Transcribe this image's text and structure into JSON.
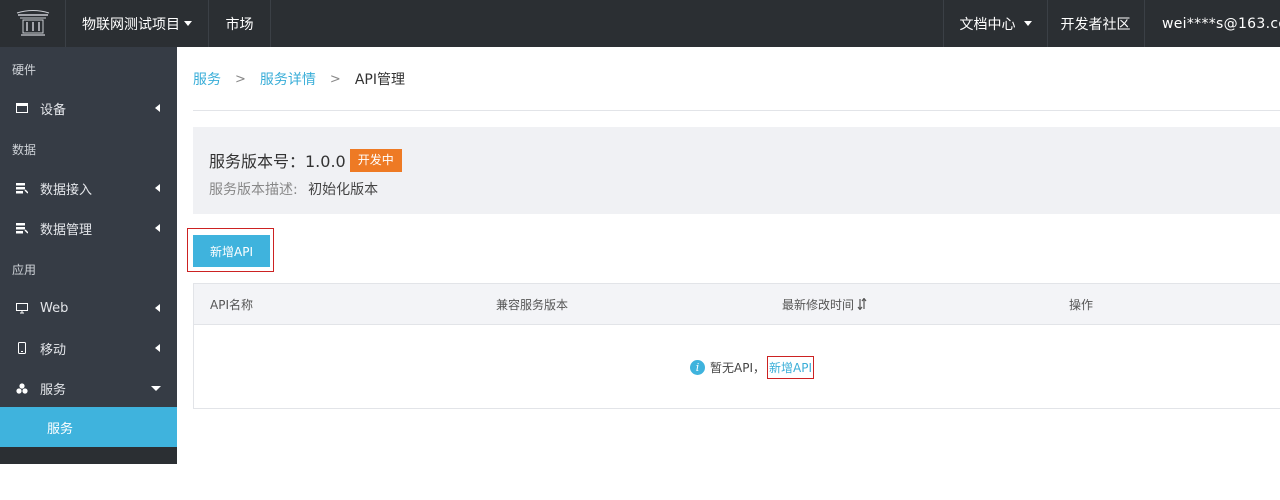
{
  "topbar": {
    "project": "物联网测试项目",
    "market": "市场",
    "docs": "文档中心",
    "community": "开发者社区",
    "user": "wei****s@163.co"
  },
  "sidebar": {
    "sections": {
      "hardware": "硬件",
      "data": "数据",
      "app": "应用"
    },
    "items": {
      "device": "设备",
      "data_ingest": "数据接入",
      "data_manage": "数据管理",
      "web": "Web",
      "mobile": "移动",
      "service": "服务"
    },
    "sub_active": "服务"
  },
  "breadcrumb": {
    "l1": "服务",
    "l2": "服务详情",
    "current": "API管理",
    "sep": ">"
  },
  "version": {
    "title": "服务版本号：1.0.0",
    "badge": "开发中",
    "desc_label": "服务版本描述:",
    "desc_value": "初始化版本"
  },
  "actions": {
    "add_api": "新增API"
  },
  "table": {
    "columns": [
      "API名称",
      "兼容服务版本",
      "最新修改时间",
      "操作"
    ],
    "empty_text": "暂无API，",
    "empty_link": "新增API"
  },
  "colors": {
    "accent": "#3fb3dd",
    "badge": "#ee7a24",
    "topbar": "#2b2f33",
    "sidebar": "#363c45"
  }
}
